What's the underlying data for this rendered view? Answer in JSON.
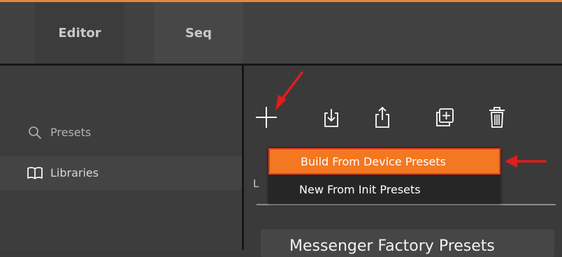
{
  "tabs": [
    {
      "label": "Editor"
    },
    {
      "label": "Seq"
    }
  ],
  "sidebar": {
    "items": [
      {
        "label": "Presets",
        "icon": "search-icon"
      },
      {
        "label": "Libraries",
        "icon": "book-icon"
      }
    ]
  },
  "toolbar": {
    "icons": [
      "add-icon",
      "import-icon",
      "share-icon",
      "duplicate-icon",
      "trash-icon"
    ]
  },
  "menu": {
    "items": [
      {
        "label": "Build From Device Presets"
      },
      {
        "label": "New From Init Presets"
      }
    ]
  },
  "list": {
    "partial_letter": "L",
    "card_title": "Messenger Factory Presets"
  },
  "colors": {
    "accent": "#f47721",
    "annotation": "#e11d1d",
    "background": "#3a3a3a"
  }
}
